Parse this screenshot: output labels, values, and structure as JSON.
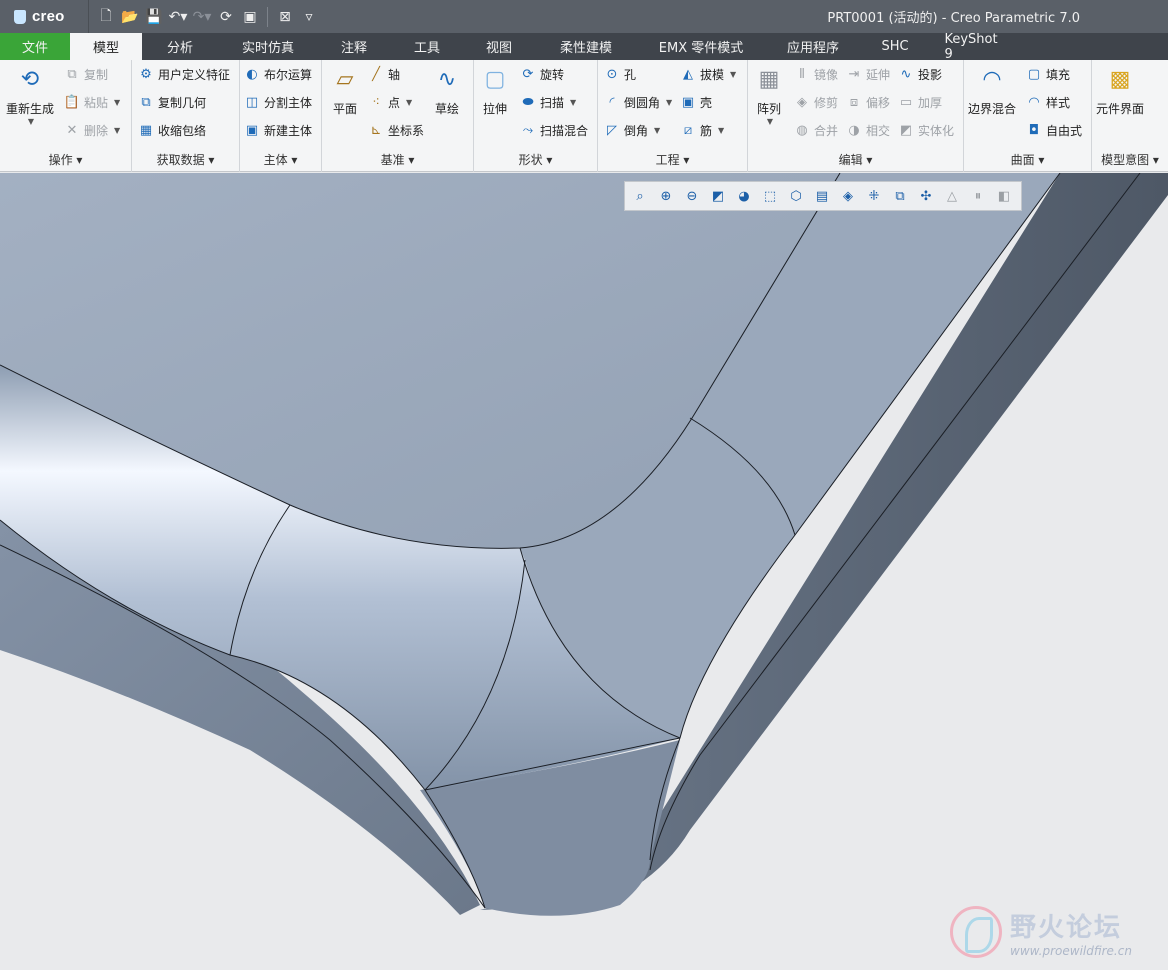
{
  "app": {
    "logo_text": "creo",
    "window_title": "PRT0001 (活动的) - Creo Parametric 7.0"
  },
  "quick_access": [
    "new-icon",
    "open-icon",
    "save-icon",
    "undo-icon",
    "redo-icon",
    "regenerate-icon",
    "windows-icon",
    "close-window-icon",
    "customize-icon"
  ],
  "tabs": [
    {
      "label": "文件"
    },
    {
      "label": "模型"
    },
    {
      "label": "分析"
    },
    {
      "label": "实时仿真"
    },
    {
      "label": "注释"
    },
    {
      "label": "工具"
    },
    {
      "label": "视图"
    },
    {
      "label": "柔性建模"
    },
    {
      "label": "EMX 零件模式"
    },
    {
      "label": "应用程序"
    },
    {
      "label": "SHC"
    },
    {
      "label": "KeyShot 9"
    }
  ],
  "ribbon": {
    "operations": {
      "label": "操作",
      "regenerate": "重新生成",
      "copy": "复制",
      "paste": "粘贴",
      "delete": "删除"
    },
    "get_data": {
      "label": "获取数据",
      "udf": "用户定义特征",
      "copy_geom": "复制几何",
      "shrinkwrap": "收缩包络"
    },
    "body": {
      "label": "主体",
      "boolean": "布尔运算",
      "split": "分割主体",
      "new_body": "新建主体"
    },
    "datum": {
      "label": "基准",
      "plane": "平面",
      "axis": "轴",
      "point": "点",
      "csys": "坐标系",
      "sketch": "草绘"
    },
    "shapes": {
      "label": "形状",
      "extrude": "拉伸",
      "revolve": "旋转",
      "sweep": "扫描",
      "swept_blend": "扫描混合"
    },
    "engineering": {
      "label": "工程",
      "hole": "孔",
      "round": "倒圆角",
      "chamfer": "倒角",
      "draft": "拔模",
      "shell": "壳",
      "rib": "筋"
    },
    "editing": {
      "label": "编辑",
      "pattern": "阵列",
      "mirror": "镜像",
      "trim": "修剪",
      "merge": "合并",
      "extend": "延伸",
      "offset": "偏移",
      "intersect": "相交",
      "project": "投影",
      "thicken": "加厚",
      "solidify": "实体化"
    },
    "surfaces": {
      "label": "曲面",
      "boundary_blend": "边界混合",
      "fill": "填充",
      "style": "样式",
      "freestyle": "自由式"
    },
    "model_intent": {
      "label": "模型意图",
      "component_interface": "元件界面"
    }
  },
  "view_toolbar": [
    "refit-icon",
    "zoom-in-icon",
    "zoom-out-icon",
    "repaint-icon",
    "display-style-icon",
    "saved-orientations-icon",
    "named-views-icon",
    "view-manager-icon",
    "perspective-icon",
    "datum-display-icon",
    "annotation-display-icon",
    "spin-center-icon",
    "simulation-icon",
    "pause-icon",
    "section-icon"
  ],
  "watermark": {
    "cn": "野火论坛",
    "url": "www.proewildfire.cn"
  }
}
